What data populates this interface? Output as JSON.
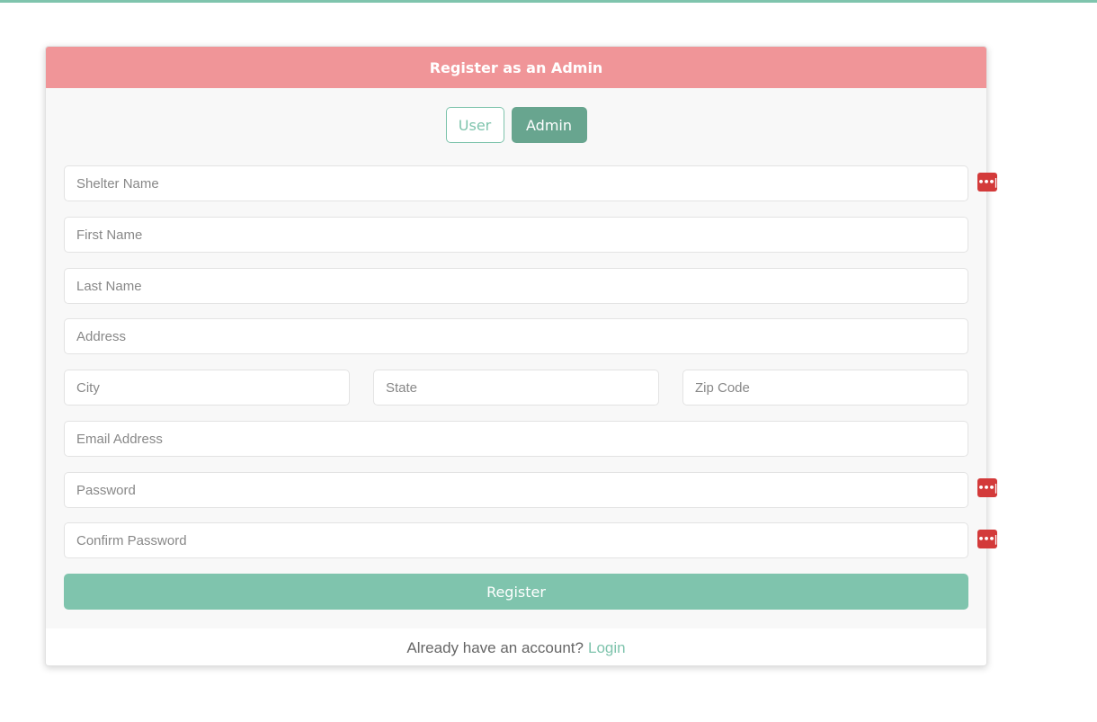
{
  "header": {
    "title": "Register as an Admin"
  },
  "role_toggle": {
    "user_label": "User",
    "admin_label": "Admin",
    "selected": "Admin"
  },
  "form": {
    "shelter_name": "Shelter Name",
    "first_name": "First Name",
    "last_name": "Last Name",
    "address": "Address",
    "city": "City",
    "state": "State",
    "zip": "Zip Code",
    "email": "Email Address",
    "password": "Password",
    "confirm_password": "Confirm Password",
    "submit_label": "Register"
  },
  "footer": {
    "prompt": "Already have an account?",
    "login_label": "Login"
  },
  "password_manager_icon": {
    "glyph": "•••|"
  },
  "colors": {
    "accent": "#7fc4ad",
    "accent_dark": "#68a58f",
    "header": "#f09598",
    "pm_icon": "#d33a3a"
  }
}
